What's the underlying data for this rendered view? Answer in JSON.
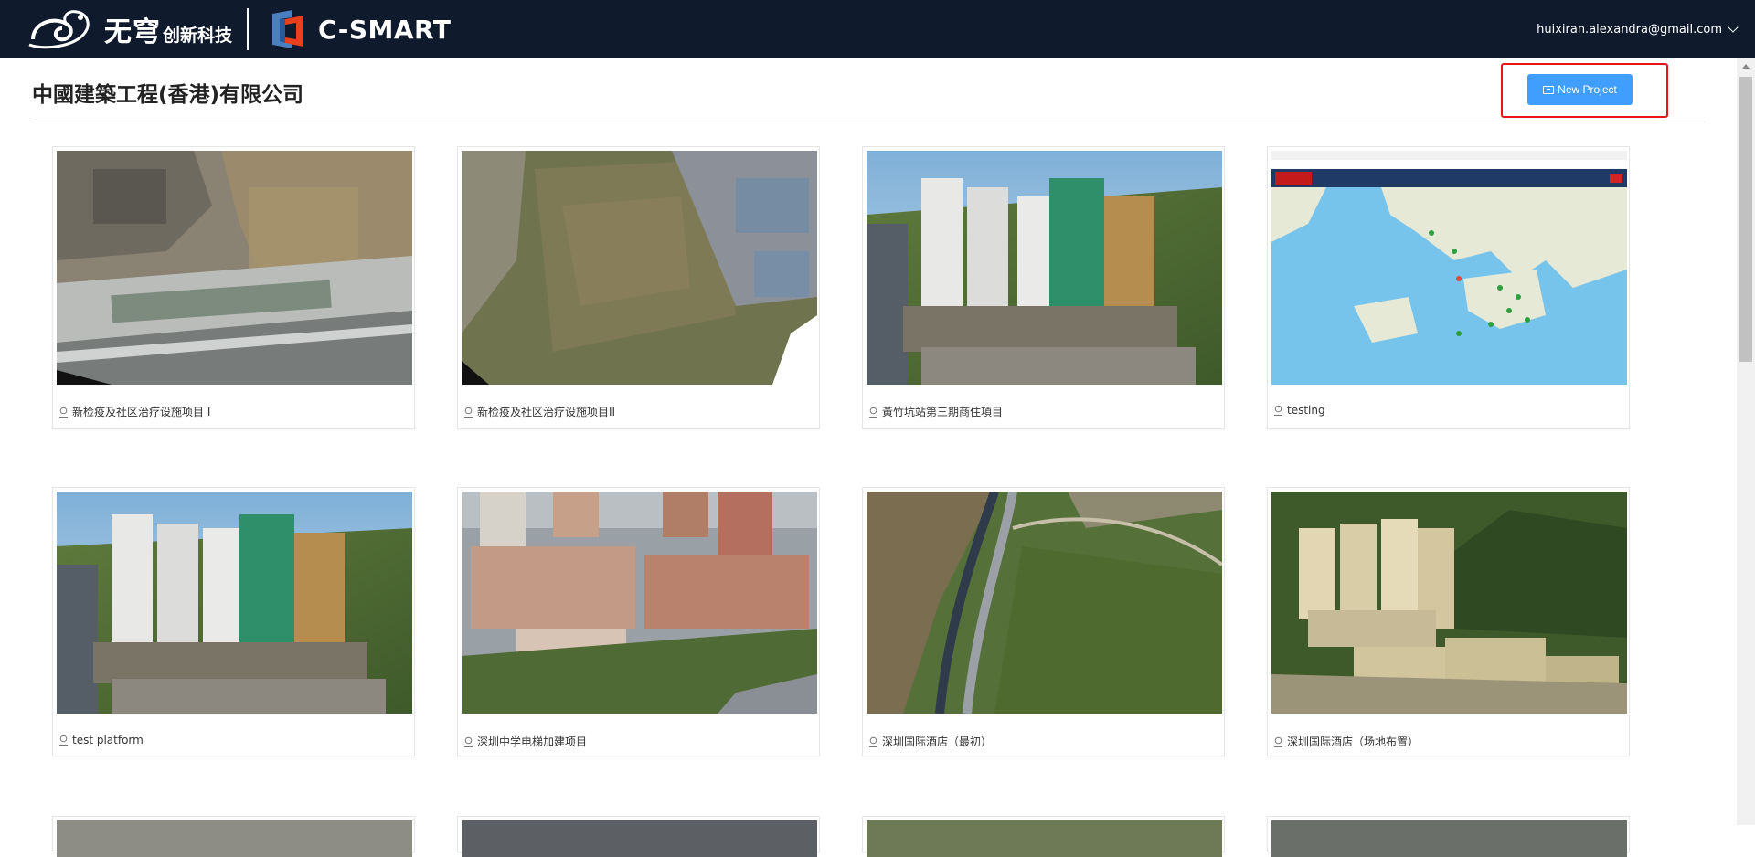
{
  "header": {
    "brand_name": "无穹",
    "brand_sub": "创新科技",
    "product_name": "C-SMART",
    "user_email": "huixiran.alexandra@gmail.com"
  },
  "page": {
    "title": "中國建築工程(香港)有限公司",
    "new_project_label": "New Project"
  },
  "projects": [
    {
      "label": "新检疫及社区治疗设施项目 I",
      "thumbnail": "aerial-site-1"
    },
    {
      "label": "新检疫及社区治疗设施项目II",
      "thumbnail": "aerial-site-2"
    },
    {
      "label": "黃竹坑站第三期商住項目",
      "thumbnail": "tower-model"
    },
    {
      "label": "testing",
      "thumbnail": "hk-map"
    },
    {
      "label": "test platform",
      "thumbnail": "tower-model"
    },
    {
      "label": "深圳中学电梯加建项目",
      "thumbnail": "school-campus"
    },
    {
      "label": "深圳国际酒店（最初）",
      "thumbnail": "hillside-road"
    },
    {
      "label": "深圳国际酒店（场地布置）",
      "thumbnail": "hotel-site"
    }
  ],
  "colors": {
    "header_bg": "#0f1b2d",
    "primary": "#409eff",
    "highlight": "#e8141b"
  }
}
